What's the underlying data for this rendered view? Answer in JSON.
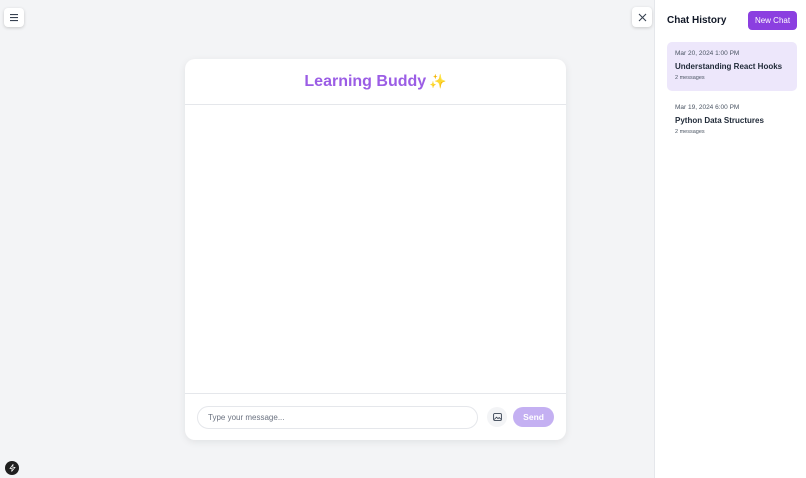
{
  "chat": {
    "title": "Learning Buddy",
    "title_emoji": "✨",
    "input_placeholder": "Type your message...",
    "input_value": "",
    "send_label": "Send"
  },
  "sidebar": {
    "title": "Chat History",
    "new_chat_label": "New Chat",
    "items": [
      {
        "date": "Mar 20, 2024 1:00 PM",
        "title": "Understanding React Hooks",
        "count": "2 messages",
        "active": true
      },
      {
        "date": "Mar 19, 2024 6:00 PM",
        "title": "Python Data Structures",
        "count": "2 messages",
        "active": false
      }
    ]
  },
  "icons": {
    "menu": "hamburger-icon",
    "close": "close-icon",
    "image": "image-icon",
    "bolt": "bolt-icon"
  },
  "colors": {
    "accent": "#8b3fe0",
    "title": "#9b5de5",
    "send_disabled": "#c4b0f2",
    "active_item": "#ede7fb"
  }
}
